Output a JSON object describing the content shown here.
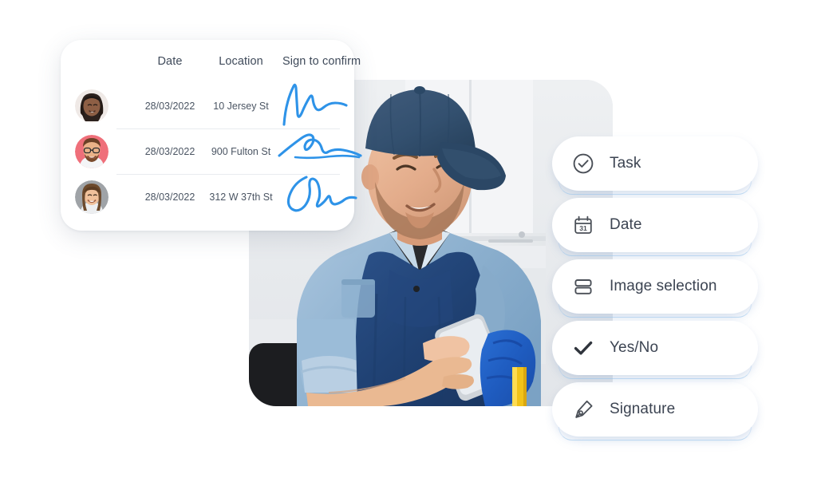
{
  "signature_card": {
    "columns": [
      "Date",
      "Location",
      "Sign to confirm"
    ],
    "rows": [
      {
        "avatar": "avatar-woman-dark-hair",
        "date": "28/03/2022",
        "location": "10 Jersey St",
        "signature": "signature-stroke-1"
      },
      {
        "avatar": "avatar-man-glasses",
        "date": "28/03/2022",
        "location": "900 Fulton St",
        "signature": "signature-stroke-2"
      },
      {
        "avatar": "avatar-woman-brown-hair",
        "date": "28/03/2022",
        "location": "312 W 37th St",
        "signature": "signature-stroke-3"
      }
    ]
  },
  "photo": {
    "alt": "Cleaning worker in blue cap and apron using a smartphone, holding a mop with blue gloves"
  },
  "field_types": [
    {
      "label": "Task",
      "icon": "check-circle-icon"
    },
    {
      "label": "Date",
      "icon": "calendar-31-icon"
    },
    {
      "label": "Image selection",
      "icon": "stacked-bars-icon"
    },
    {
      "label": "Yes/No",
      "icon": "checkmark-icon"
    },
    {
      "label": "Signature",
      "icon": "pen-nib-icon"
    }
  ],
  "colors": {
    "signature_ink": "#2e93e8",
    "pill_text": "#3c4452",
    "table_text": "#4b5563",
    "header_text": "#3f4a5a",
    "pill_border_glow": "#96c3eb",
    "page_background": "#ffffff"
  }
}
